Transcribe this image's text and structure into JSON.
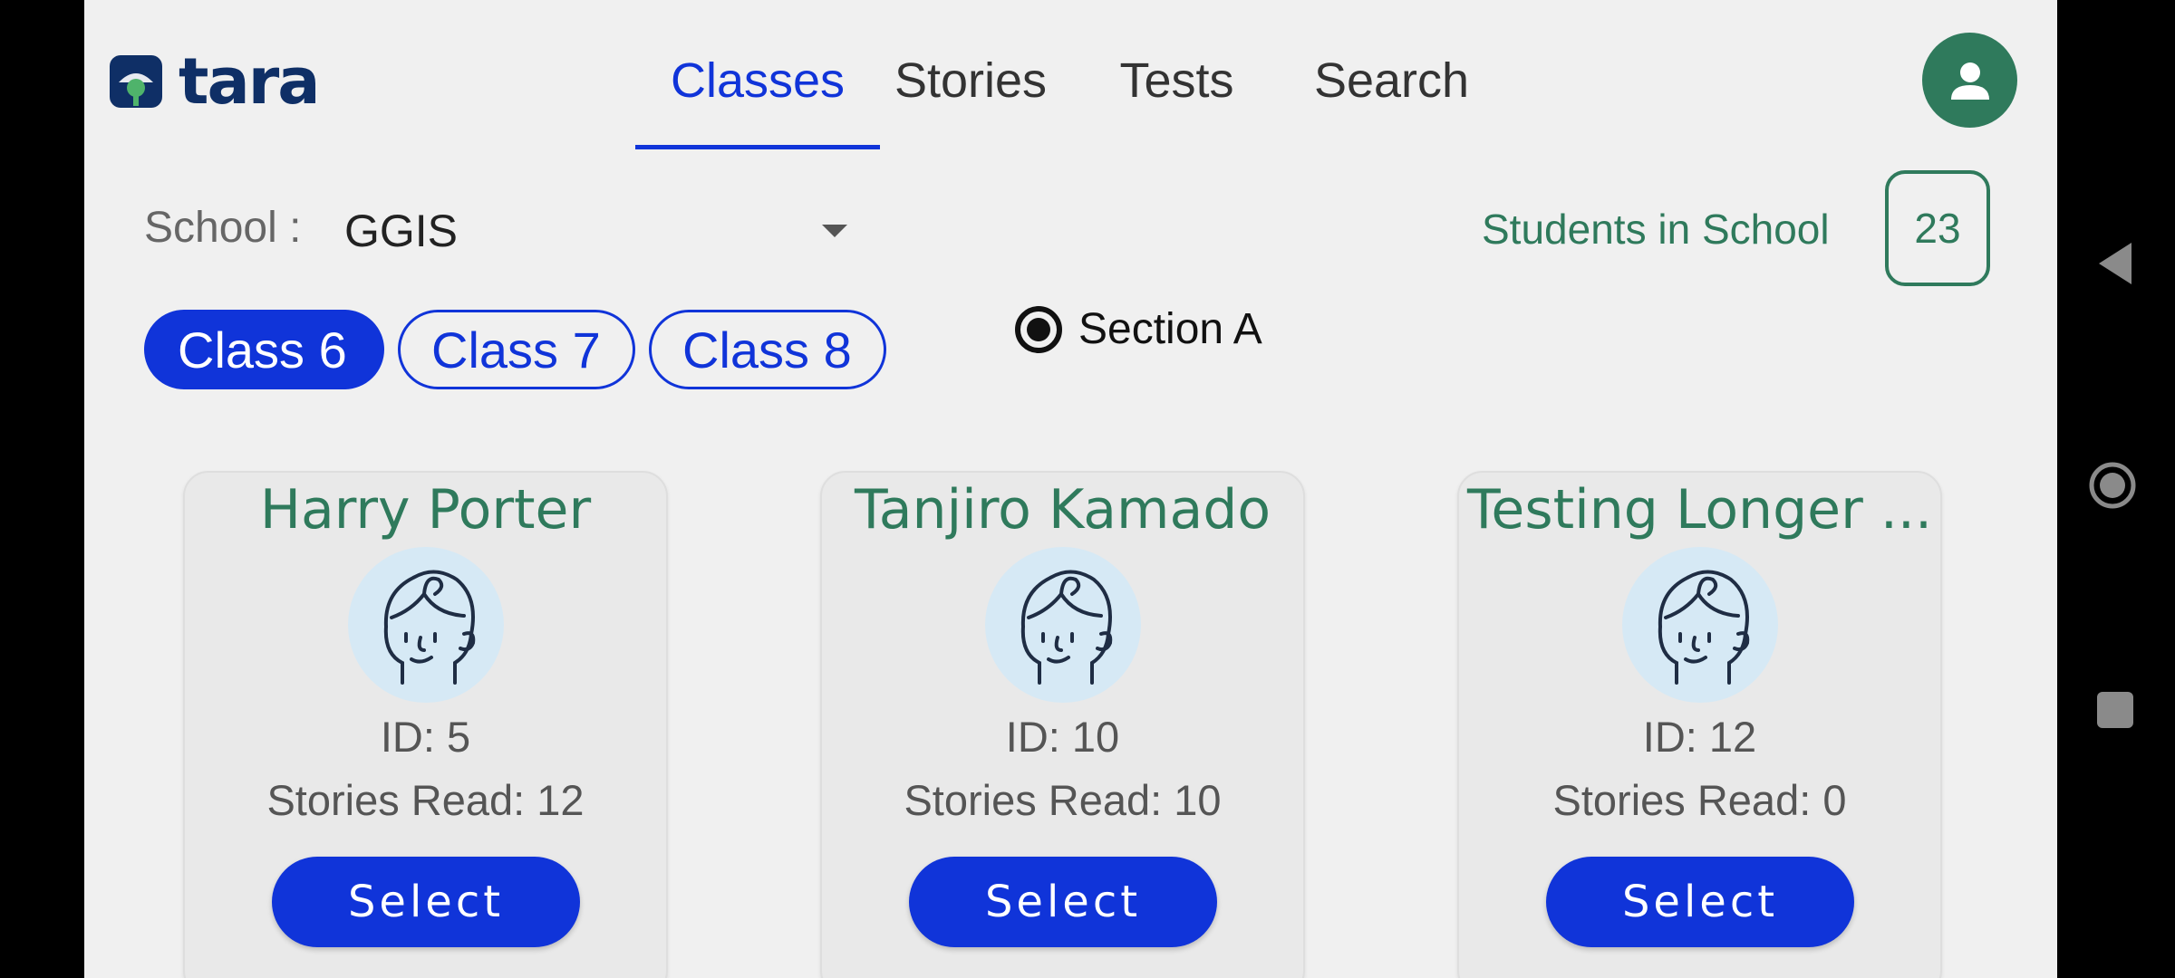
{
  "header": {
    "logo_text": "tara",
    "tabs": [
      {
        "label": "Classes",
        "active": true
      },
      {
        "label": "Stories",
        "active": false
      },
      {
        "label": "Tests",
        "active": false
      },
      {
        "label": "Search",
        "active": false
      }
    ]
  },
  "school": {
    "label": "School :",
    "value": "GGIS"
  },
  "students": {
    "label": "Students in School",
    "count": "23"
  },
  "classes": {
    "pills": [
      {
        "label": "Class 6",
        "active": true
      },
      {
        "label": "Class 7",
        "active": false
      },
      {
        "label": "Class 8",
        "active": false
      }
    ]
  },
  "section": {
    "label": "Section A",
    "selected": true
  },
  "students_list": [
    {
      "name": "Harry Porter",
      "id": "ID: 5",
      "stories": "Stories Read: 12",
      "button": "Select"
    },
    {
      "name": "Tanjiro Kamado",
      "id": "ID: 10",
      "stories": "Stories Read: 10",
      "button": "Select"
    },
    {
      "name": "Testing Longer ...",
      "id": "ID: 12",
      "stories": "Stories Read: 0",
      "button": "Select"
    }
  ],
  "colors": {
    "accent_blue": "#1034d9",
    "brand_green": "#2f7a5c",
    "logo_navy": "#0f2f66",
    "avatar_bg": "#d6e9f5"
  },
  "icons": {
    "profile": "person-icon",
    "dropdown": "chevron-down-icon",
    "nav_back": "triangle-back-icon",
    "nav_home": "circle-home-icon",
    "nav_recent": "square-recent-icon"
  }
}
